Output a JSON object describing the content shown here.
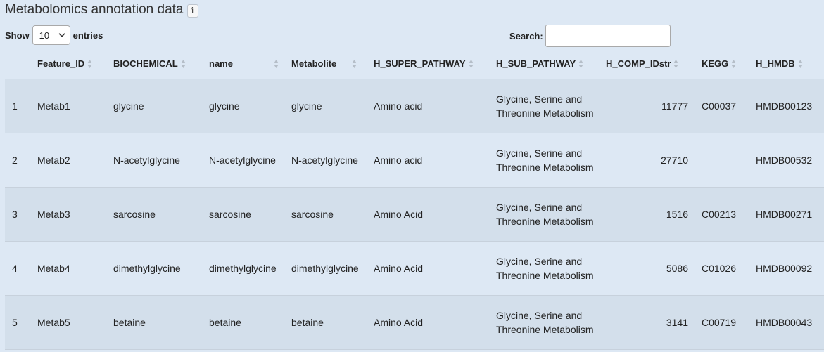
{
  "header": {
    "title": "Metabolomics annotation data",
    "info_icon_text": "i"
  },
  "controls": {
    "show_label": "Show",
    "entries_value": "10",
    "entries_label": "entries",
    "search_label": "Search:",
    "search_value": ""
  },
  "table": {
    "columns": [
      "",
      "Feature_ID",
      "BIOCHEMICAL",
      "name",
      "Metabolite",
      "H_SUPER_PATHWAY",
      "H_SUB_PATHWAY",
      "H_COMP_IDstr",
      "KEGG",
      "H_HMDB"
    ],
    "rows": [
      [
        "1",
        "Metab1",
        "glycine",
        "glycine",
        "glycine",
        "Amino acid",
        "Glycine, Serine and Threonine Metabolism",
        "11777",
        "C00037",
        "HMDB00123"
      ],
      [
        "2",
        "Metab2",
        "N-acetylglycine",
        "N-acetylglycine",
        "N-acetylglycine",
        "Amino acid",
        "Glycine, Serine and Threonine Metabolism",
        "27710",
        "",
        "HMDB00532"
      ],
      [
        "3",
        "Metab3",
        "sarcosine",
        "sarcosine",
        "sarcosine",
        "Amino Acid",
        "Glycine, Serine and Threonine Metabolism",
        "1516",
        "C00213",
        "HMDB00271"
      ],
      [
        "4",
        "Metab4",
        "dimethylglycine",
        "dimethylglycine",
        "dimethylglycine",
        "Amino Acid",
        "Glycine, Serine and Threonine Metabolism",
        "5086",
        "C01026",
        "HMDB00092"
      ],
      [
        "5",
        "Metab5",
        "betaine",
        "betaine",
        "betaine",
        "Amino Acid",
        "Glycine, Serine and Threonine Metabolism",
        "3141",
        "C00719",
        "HMDB00043"
      ]
    ]
  },
  "icons": {
    "sort": "sort-icon",
    "select_chevron": "chevron-down-icon",
    "info": "info-icon"
  }
}
